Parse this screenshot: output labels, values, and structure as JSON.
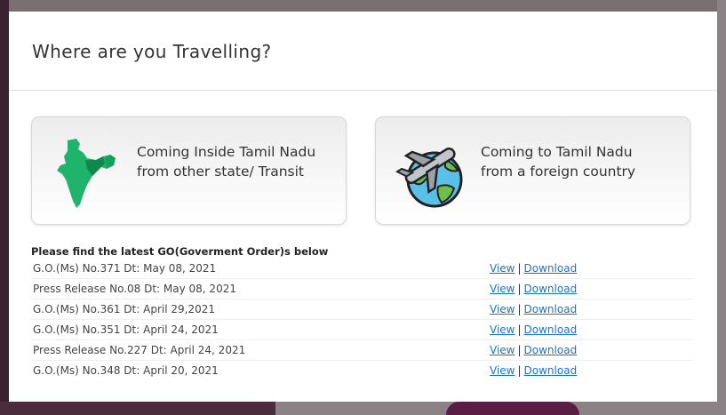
{
  "modal": {
    "title": "Where are you Travelling?"
  },
  "cards": [
    {
      "line1": "Coming Inside Tamil Nadu",
      "line2": "from other state/ Transit",
      "icon": "india-map-icon"
    },
    {
      "line1": "Coming to Tamil Nadu",
      "line2": "from a foreign country",
      "icon": "globe-airplane-icon"
    }
  ],
  "go": {
    "heading": "Please find the latest GO(Goverment Order)s below",
    "view_label": "View",
    "separator": "|",
    "download_label": "Download",
    "items": [
      "G.O.(Ms) No.371 Dt: May 08, 2021",
      "Press Release No.08 Dt: May 08, 2021",
      "G.O.(Ms) No.361 Dt: April 29,2021",
      "G.O.(Ms) No.351 Dt: April 24, 2021",
      "Press Release No.227 Dt: April 24, 2021",
      "G.O.(Ms) No.348 Dt: April 20, 2021"
    ]
  },
  "colors": {
    "link": "#1a73c9",
    "india_green": "#1fb36b",
    "india_dark_green": "#0f8a4d"
  }
}
